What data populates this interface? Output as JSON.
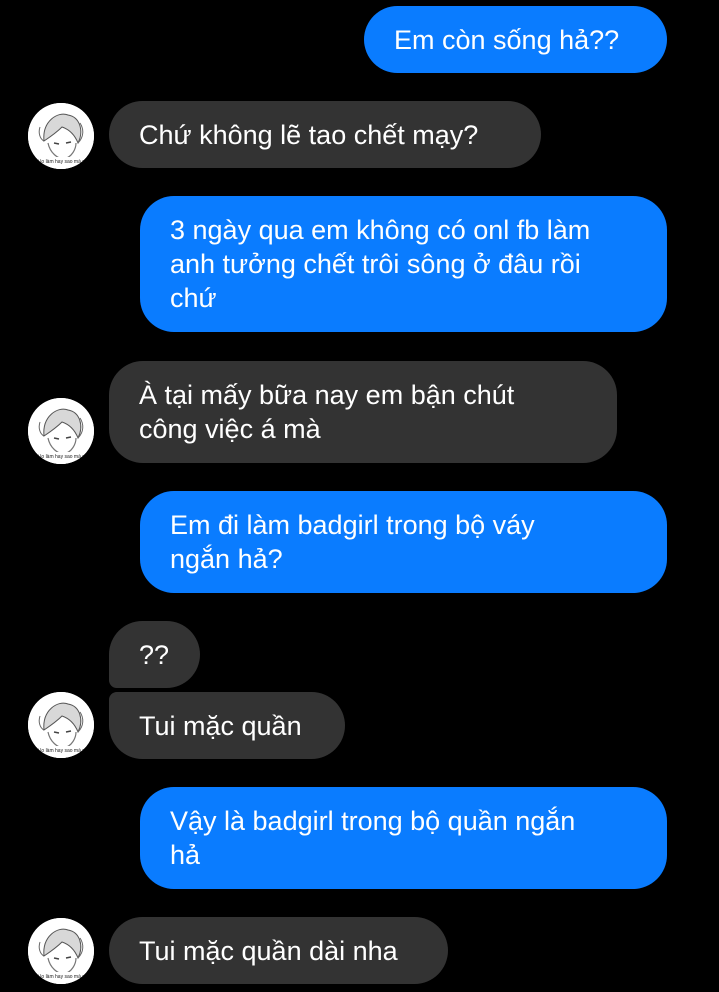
{
  "conversation": {
    "messages": [
      {
        "direction": "outgoing",
        "text": "Em còn sống hả??"
      },
      {
        "direction": "incoming",
        "text": "Chứ không lẽ tao chết mạy?"
      },
      {
        "direction": "outgoing",
        "text": "3 ngày qua em không có onl fb làm\nanh tưởng chết trôi sông ở đâu rồi\nchứ"
      },
      {
        "direction": "incoming",
        "text": "À tại mấy bữa nay em bận chút\ncông việc á mà"
      },
      {
        "direction": "outgoing",
        "text": "Em đi làm badgirl trong bộ váy\nngắn hả?"
      },
      {
        "direction": "incoming",
        "text": "??"
      },
      {
        "direction": "incoming",
        "text": "Tui mặc quần"
      },
      {
        "direction": "outgoing",
        "text": "Vậy là badgirl trong bộ quần ngắn\nhả"
      },
      {
        "direction": "incoming",
        "text": "Tui mặc quần dài nha"
      }
    ],
    "avatar_caption": "Bộ t lo làm hay sao mà nhìn"
  },
  "colors": {
    "background": "#000000",
    "outgoing_bubble": "#0a7cff",
    "incoming_bubble": "#333333",
    "text": "#ffffff"
  },
  "icons": {
    "avatar": "anime-character-avatar"
  }
}
